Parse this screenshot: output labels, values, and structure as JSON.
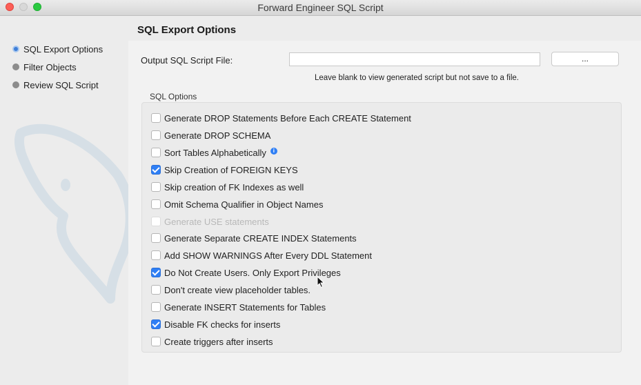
{
  "window": {
    "title": "Forward Engineer SQL Script"
  },
  "sidebar": {
    "items": [
      {
        "label": "SQL Export Options",
        "active": true
      },
      {
        "label": "Filter Objects",
        "active": false
      },
      {
        "label": "Review SQL Script",
        "active": false
      }
    ]
  },
  "main": {
    "title": "SQL Export Options",
    "output": {
      "label": "Output SQL Script File:",
      "value": "",
      "browse_label": "...",
      "hint": "Leave blank to view generated script but not save to a file."
    },
    "options_group": {
      "label": "SQL Options",
      "options": [
        {
          "label": "Generate DROP Statements Before Each CREATE Statement",
          "checked": false,
          "disabled": false
        },
        {
          "label": "Generate DROP SCHEMA",
          "checked": false,
          "disabled": false
        },
        {
          "label": "Sort Tables Alphabetically",
          "checked": false,
          "disabled": false,
          "info": "i"
        },
        {
          "label": "Skip Creation of FOREIGN KEYS",
          "checked": true,
          "disabled": false
        },
        {
          "label": "Skip creation of FK Indexes as well",
          "checked": false,
          "disabled": false
        },
        {
          "label": "Omit Schema Qualifier in Object Names",
          "checked": false,
          "disabled": false
        },
        {
          "label": "Generate USE statements",
          "checked": false,
          "disabled": true
        },
        {
          "label": "Generate Separate CREATE INDEX Statements",
          "checked": false,
          "disabled": false
        },
        {
          "label": "Add SHOW WARNINGS After Every DDL Statement",
          "checked": false,
          "disabled": false
        },
        {
          "label": "Do Not Create Users. Only Export Privileges",
          "checked": true,
          "disabled": false
        },
        {
          "label": "Don't create view placeholder tables.",
          "checked": false,
          "disabled": false
        },
        {
          "label": "Generate INSERT Statements for Tables",
          "checked": false,
          "disabled": false
        },
        {
          "label": "Disable FK checks for inserts",
          "checked": true,
          "disabled": false
        },
        {
          "label": "Create triggers after inserts",
          "checked": false,
          "disabled": false
        }
      ]
    }
  },
  "colors": {
    "accent": "#2f7ff5",
    "close": "#fc5f57",
    "maximize": "#2ac940"
  }
}
